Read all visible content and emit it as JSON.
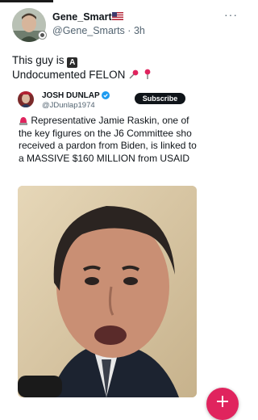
{
  "tweet": {
    "author_name": "Gene_Smarts",
    "author_flag": "us-flag-icon",
    "author_handle": "@Gene_Smarts",
    "time_separator": "·",
    "time": "3h",
    "more_label": "···",
    "text_line1": "This guy is",
    "text_letter": "A",
    "text_line2": "Undocumented FELON"
  },
  "quote": {
    "author_name": "JOSH DUNLAP",
    "author_handle": "@JDunlap1974",
    "subscribe_label": "Subscribe",
    "text": "Representative Jamie Raskin, one of the key figures on the J6 Committee sho received a pardon from Biden, is linked to a MASSIVE $160 MILLION from USAID"
  },
  "colors": {
    "accent": "#e0245e",
    "verified": "#1d9bf0",
    "text_primary": "#0f1419",
    "text_secondary": "#536471"
  }
}
